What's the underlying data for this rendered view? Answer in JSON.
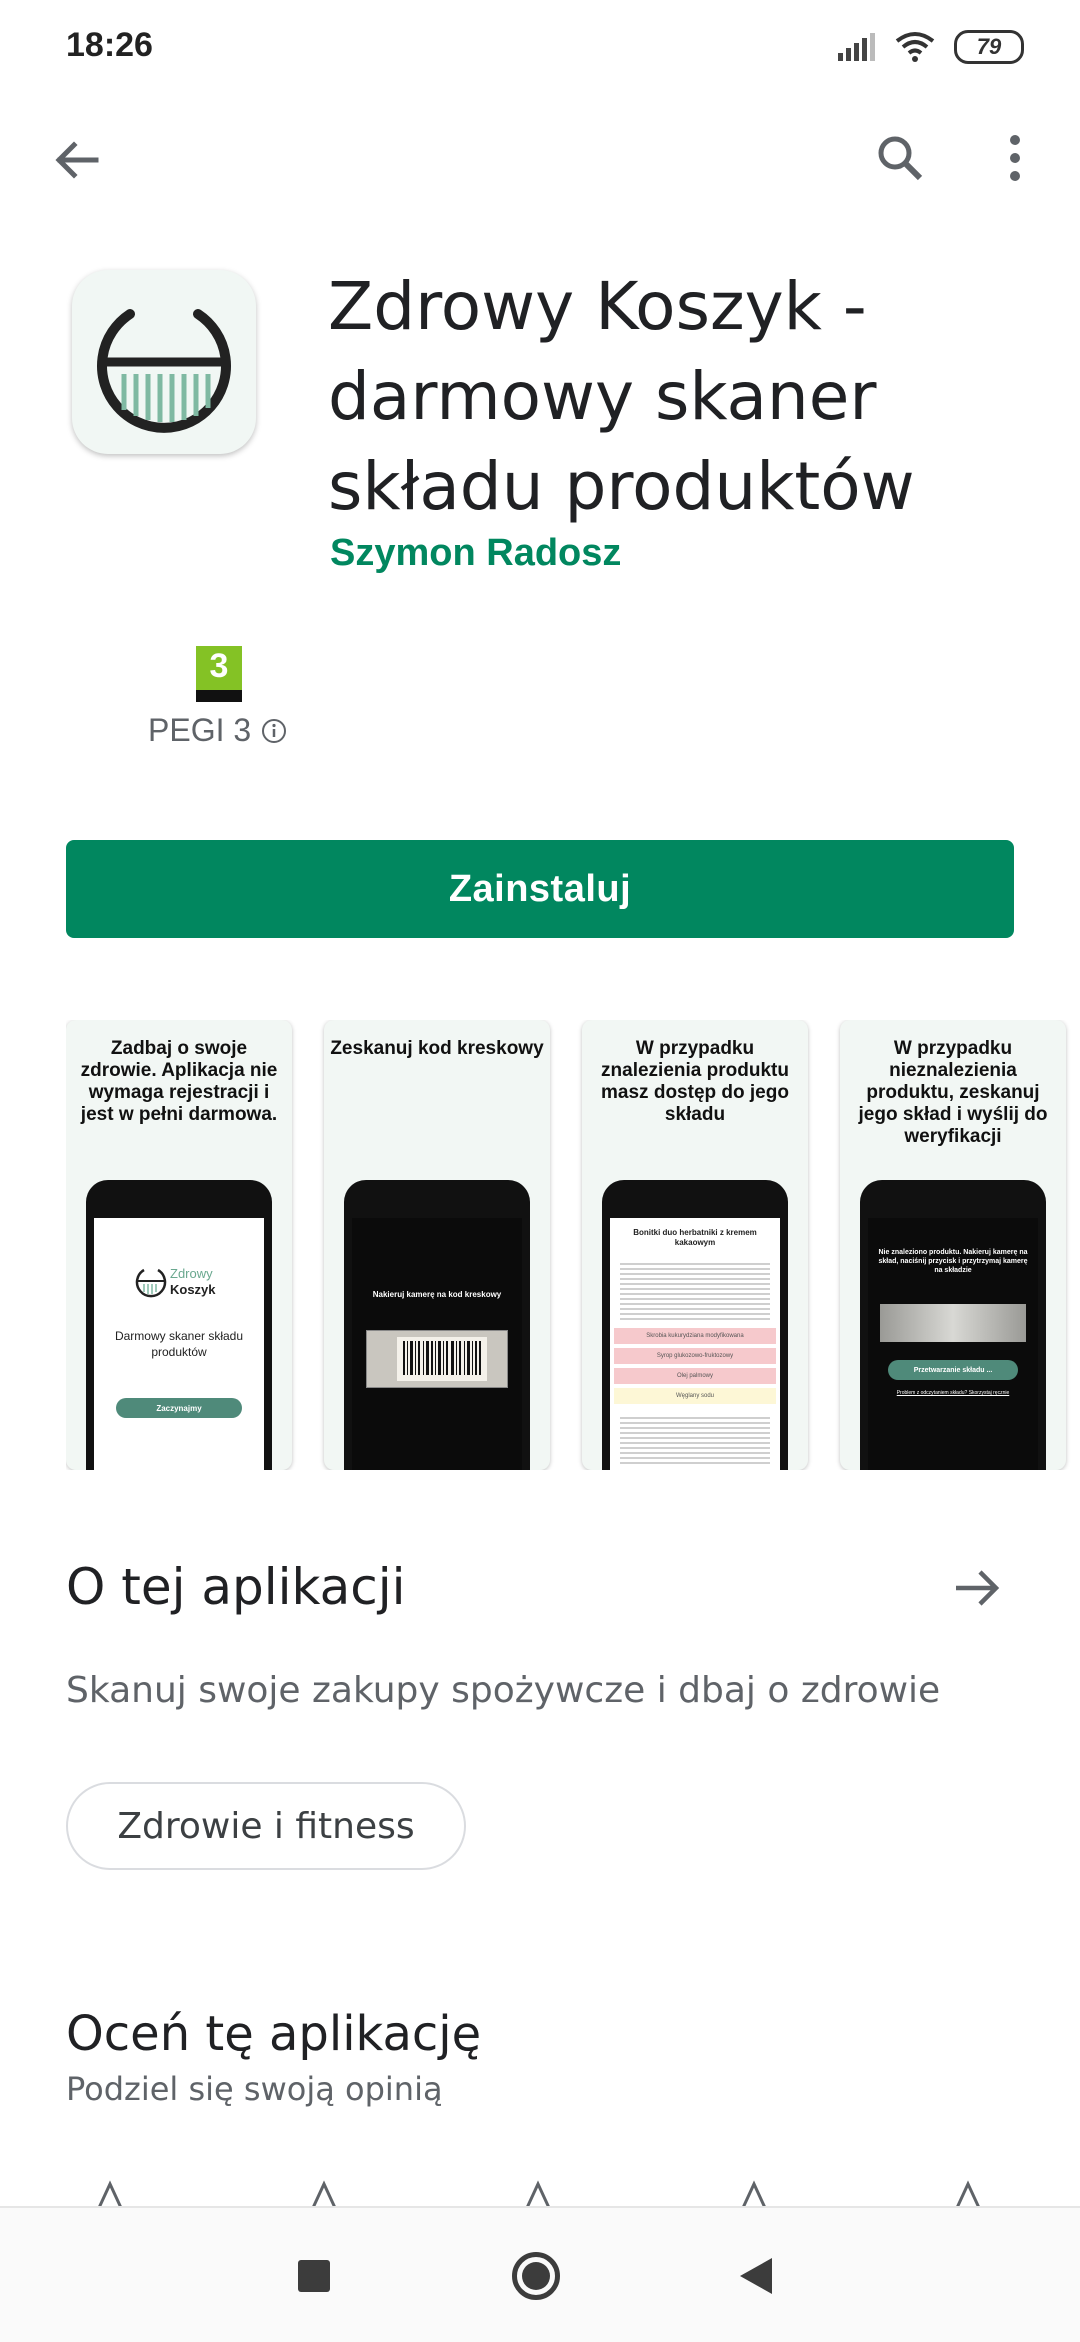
{
  "status_bar": {
    "time": "18:26",
    "battery": "79",
    "icons": [
      "signal-icon",
      "wifi-icon",
      "battery-icon"
    ]
  },
  "app_bar": {
    "icons": [
      "back-arrow-icon",
      "search-icon",
      "more-vert-icon"
    ]
  },
  "app": {
    "title": "Zdrowy Koszyk - darmowy skaner składu produktów",
    "developer": "Szymon Radosz",
    "rating_badge": "3",
    "rating_label": "PEGI 3",
    "install_label": "Zainstaluj",
    "accent_color": "#01875f"
  },
  "screenshots": [
    {
      "caption": "Zadbaj o swoje zdrowie. Aplikacja nie wymaga rejestracji i jest w pełni darmowa.",
      "screen": {
        "brand_line1": "Zdrowy",
        "brand_line2": "Koszyk",
        "text": "Darmowy skaner składu produktów",
        "button": "Zaczynajmy"
      }
    },
    {
      "caption": "Zeskanuj kod kreskowy",
      "screen": {
        "text": "Nakieruj kamerę na kod kreskowy"
      }
    },
    {
      "caption": "W przypadku znalezienia produktu masz dostęp do jego składu",
      "screen": {
        "product": "Bonitki duo herbatniki z kremem kakaowym",
        "items": [
          "Skrobia kukurydziana modyfikowana",
          "Syrop glukozowo-fruktozowy",
          "Olej palmowy",
          "Węglany sodu"
        ]
      }
    },
    {
      "caption": "W przypadku nieznalezienia produktu, zeskanuj jego skład i wyślij do weryfikacji",
      "screen": {
        "text": "Nie znaleziono produktu. Nakieruj kamerę na skład, naciśnij przycisk i przytrzymaj kamerę na składzie",
        "button": "Przetwarzanie składu ...",
        "link": "Problem z odczytaniem składu? Skorzystaj ręcznie"
      }
    }
  ],
  "about": {
    "title": "O tej aplikacji",
    "description": "Skanuj swoje zakupy spożywcze i dbaj o zdrowie",
    "category": "Zdrowie i fitness"
  },
  "rate": {
    "title": "Oceń tę aplikację",
    "subtitle": "Podziel się swoją opinią"
  },
  "nav_bar": {
    "icons": [
      "recents-icon",
      "home-icon",
      "back-icon"
    ]
  }
}
